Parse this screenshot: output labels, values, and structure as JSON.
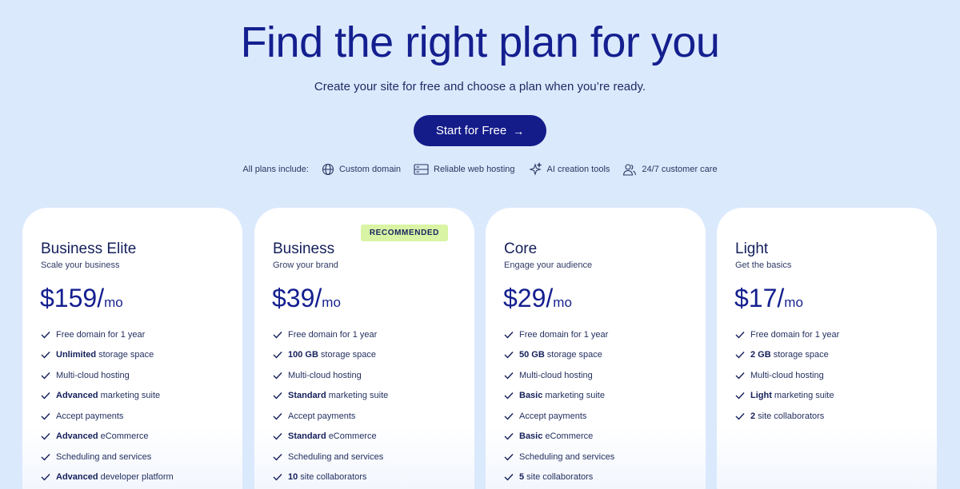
{
  "hero": {
    "title": "Find the right plan for you",
    "subtitle": "Create your site for free and choose a plan when you’re ready.",
    "cta_label": "Start for Free",
    "cta_icon": "arrow-right-icon"
  },
  "includes": {
    "lead": "All plans include:",
    "items": [
      {
        "label": "Custom domain",
        "icon": "globe-icon"
      },
      {
        "label": "Reliable web hosting",
        "icon": "server-icon"
      },
      {
        "label": "AI creation tools",
        "icon": "sparkle-icon"
      },
      {
        "label": "24/7 customer care",
        "icon": "people-icon"
      }
    ]
  },
  "colors": {
    "background": "#dbe9fd",
    "accent": "#141c8a",
    "badge": "#d8f4a4"
  },
  "plans": [
    {
      "name": "Business Elite",
      "tagline": "Scale your business",
      "price": "$159",
      "period": "mo",
      "features": [
        {
          "bold": "",
          "text": "Free domain for 1 year"
        },
        {
          "bold": "Unlimited",
          "text": "storage space"
        },
        {
          "bold": "",
          "text": "Multi-cloud hosting"
        },
        {
          "bold": "Advanced",
          "text": "marketing suite"
        },
        {
          "bold": "",
          "text": "Accept payments"
        },
        {
          "bold": "Advanced",
          "text": "eCommerce"
        },
        {
          "bold": "",
          "text": "Scheduling and services"
        },
        {
          "bold": "Advanced",
          "text": "developer platform"
        }
      ]
    },
    {
      "name": "Business",
      "tagline": "Grow your brand",
      "price": "$39",
      "period": "mo",
      "badge": "RECOMMENDED",
      "features": [
        {
          "bold": "",
          "text": "Free domain for 1 year"
        },
        {
          "bold": "100 GB",
          "text": "storage space"
        },
        {
          "bold": "",
          "text": "Multi-cloud hosting"
        },
        {
          "bold": "Standard",
          "text": "marketing suite"
        },
        {
          "bold": "",
          "text": "Accept payments"
        },
        {
          "bold": "Standard",
          "text": "eCommerce"
        },
        {
          "bold": "",
          "text": "Scheduling and services"
        },
        {
          "bold": "10",
          "text": "site collaborators"
        }
      ]
    },
    {
      "name": "Core",
      "tagline": "Engage your audience",
      "price": "$29",
      "period": "mo",
      "features": [
        {
          "bold": "",
          "text": "Free domain for 1 year"
        },
        {
          "bold": "50 GB",
          "text": "storage space"
        },
        {
          "bold": "",
          "text": "Multi-cloud hosting"
        },
        {
          "bold": "Basic",
          "text": "marketing suite"
        },
        {
          "bold": "",
          "text": "Accept payments"
        },
        {
          "bold": "Basic",
          "text": "eCommerce"
        },
        {
          "bold": "",
          "text": "Scheduling and services"
        },
        {
          "bold": "5",
          "text": "site collaborators"
        }
      ]
    },
    {
      "name": "Light",
      "tagline": "Get the basics",
      "price": "$17",
      "period": "mo",
      "features": [
        {
          "bold": "",
          "text": "Free domain for 1 year"
        },
        {
          "bold": "2 GB",
          "text": "storage space"
        },
        {
          "bold": "",
          "text": "Multi-cloud hosting"
        },
        {
          "bold": "Light",
          "text": "marketing suite"
        },
        {
          "bold": "2",
          "text": "site collaborators"
        }
      ]
    }
  ]
}
